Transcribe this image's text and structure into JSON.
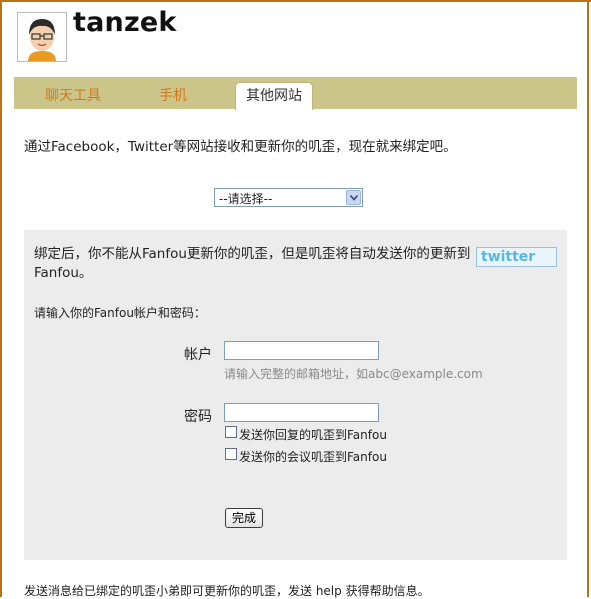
{
  "user": {
    "name": "tanzek"
  },
  "tabs": [
    {
      "label": "聊天工具",
      "active": false
    },
    {
      "label": "手机",
      "active": false
    },
    {
      "label": "其他网站",
      "active": true
    }
  ],
  "intro": "通过Facebook，Twitter等网站接收和更新你的叽歪，现在就来绑定吧。",
  "site_select": {
    "selected": "--请选择--"
  },
  "bind_panel": {
    "description": "绑定后，你不能从Fanfou更新你的叽歪，但是叽歪将自动发送你的更新到Fanfou。",
    "badge_text": "twitter",
    "prompt": "请输入你的Fanfou帐户和密码：",
    "account_label": "帐户",
    "account_value": "",
    "account_hint": "请输入完整的邮箱地址，如abc@example.com",
    "password_label": "密码",
    "password_value": "",
    "option_replies": "发送你回复的叽歪到Fanfou",
    "option_meetings": "发送你的会议叽歪到Fanfou",
    "submit_label": "完成"
  },
  "footer": "发送消息给已绑定的叽歪小弟即可更新你的叽歪，发送 help 获得帮助信息。",
  "colors": {
    "frame": "#b5741c",
    "tabbar": "#ccc58a",
    "tab_text": "#d07a1c",
    "panel": "#ececec",
    "twitter": "#55b9e6"
  }
}
